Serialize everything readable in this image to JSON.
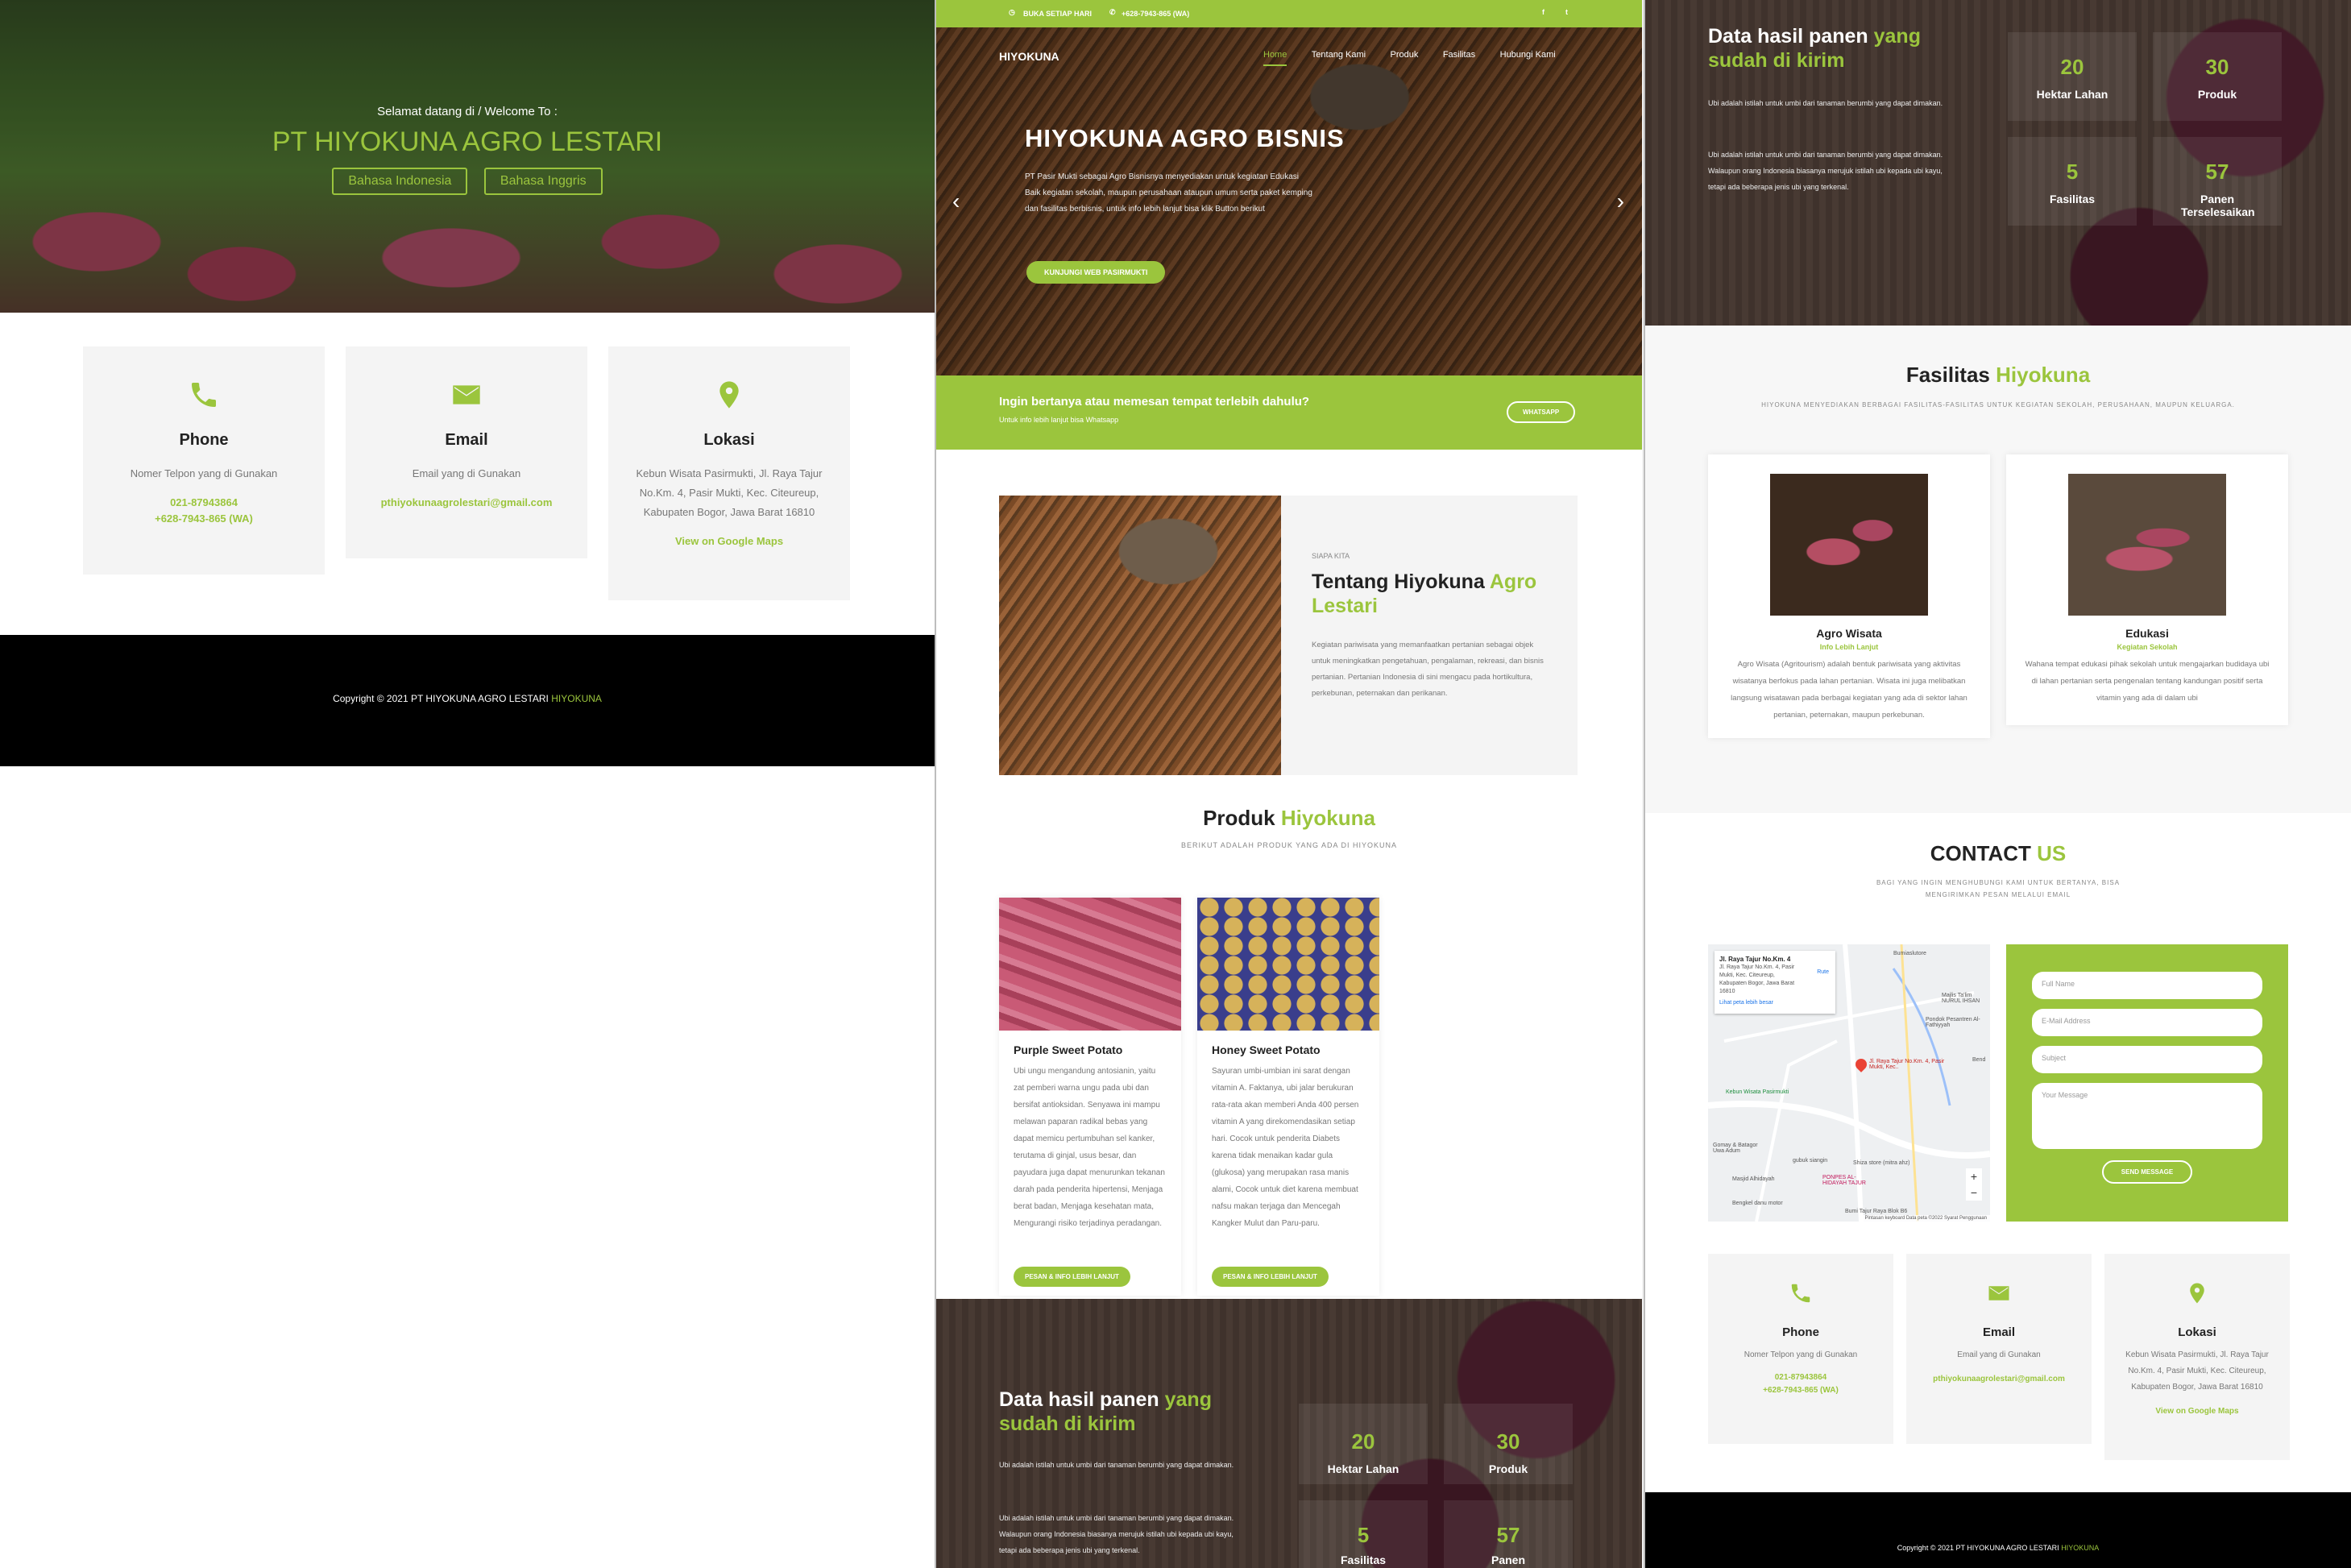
{
  "left": {
    "hero": {
      "welcome": "Selamat datang di / Welcome To :",
      "title": "PT HIYOKUNA AGRO LESTARI",
      "btn_id": "Bahasa Indonesia",
      "btn_en": "Bahasa Inggris"
    },
    "contact": [
      {
        "title": "Phone",
        "desc": "Nomer Telpon yang di Gunakan",
        "l1": "021-87943864",
        "l2": "+628-7943-865 (WA)"
      },
      {
        "title": "Email",
        "desc": "Email yang di Gunakan",
        "l1": "pthiyokunaagrolestari@gmail.com"
      },
      {
        "title": "Lokasi",
        "desc": "Kebun Wisata Pasirmukti, Jl. Raya Tajur No.Km. 4, Pasir Mukti, Kec. Citeureup, Kabupaten Bogor, Jawa Barat 16810",
        "l1": "View on Google Maps"
      }
    ],
    "footer": {
      "text": "Copyright © 2021 PT HIYOKUNA AGRO LESTARI",
      "brand": "HIYOKUNA"
    }
  },
  "mid": {
    "topbar": {
      "hours": "BUKA SETIAP HARI",
      "phone": "+628-7943-865 (WA)",
      "fb": "f",
      "tw": "t"
    },
    "nav": {
      "logo": "HIYOKUNA",
      "items": [
        "Home",
        "Tentang Kami",
        "Produk",
        "Fasilitas",
        "Hubungi Kami"
      ]
    },
    "hero": {
      "title": "HIYOKUNA AGRO BISNIS",
      "text": "PT Pasir Mukti sebagai Agro Bisnisnya menyediakan untuk kegiatan Edukasi Baik kegiatan sekolah, maupun perusahaan ataupun umum serta paket kemping dan fasilitas berbisnis, untuk info lebih lanjut bisa klik Button berikut",
      "btn": "KUNJUNGI WEB PASIRMUKTI",
      "prev": "‹",
      "next": "›"
    },
    "cta": {
      "title": "Ingin bertanya atau memesan tempat terlebih dahulu?",
      "sub": "Untuk info lebih lanjut bisa Whatsapp",
      "btn": "WHATSAPP"
    },
    "about": {
      "kicker": "SIAPA KITA",
      "t1": "Tentang Hiyokuna",
      "t2": "Agro",
      "t3": "Lestari",
      "text": "Kegiatan pariwisata yang memanfaatkan pertanian sebagai objek untuk meningkatkan pengetahuan, pengalaman, rekreasi, dan bisnis pertanian. Pertanian Indonesia di sini mengacu pada hortikultura, perkebunan, peternakan dan perikanan."
    },
    "produk": {
      "t1": "Produk",
      "t2": "Hiyokuna",
      "sub": "BERIKUT ADALAH PRODUK YANG ADA DI HIYOKUNA",
      "items": [
        {
          "name": "Purple Sweet Potato",
          "desc": "Ubi ungu mengandung antosianin, yaitu zat pemberi warna ungu pada ubi dan bersifat antioksidan. Senyawa ini mampu melawan paparan radikal bebas yang dapat memicu pertumbuhan sel kanker, terutama di ginjal, usus besar, dan payudara juga dapat menurunkan tekanan darah pada penderita hipertensi, Menjaga berat badan, Menjaga kesehatan mata, Mengurangi risiko terjadinya peradangan.",
          "btn": "PESAN & INFO LEBIH LANJUT"
        },
        {
          "name": "Honey Sweet Potato",
          "desc": "Sayuran umbi-umbian ini sarat dengan vitamin A. Faktanya, ubi jalar berukuran rata-rata akan memberi Anda 400 persen vitamin A yang direkomendasikan setiap hari. Cocok untuk penderita Diabets karena tidak menaikan kadar gula (glukosa) yang merupakan rasa manis alami, Cocok untuk diet karena membuat nafsu makan terjaga dan Mencegah Kangker Mulut dan Paru-paru.",
          "btn": "PESAN & INFO LEBIH LANJUT"
        }
      ]
    },
    "stats": {
      "t1": "Data hasil panen",
      "t2": "yang",
      "t3": "sudah di kirim",
      "p1": "Ubi adalah istilah untuk umbi dari tanaman berumbi yang dapat dimakan.",
      "p2": "Ubi adalah istilah untuk umbi dari tanaman berumbi yang dapat dimakan. Walaupun orang Indonesia biasanya merujuk istilah ubi kepada ubi kayu, tetapi ada beberapa jenis ubi yang terkenal.",
      "items": [
        {
          "n": "20",
          "l": "Hektar Lahan"
        },
        {
          "n": "30",
          "l": "Produk"
        },
        {
          "n": "5",
          "l": "Fasilitas"
        },
        {
          "n": "57",
          "l": "Panen"
        }
      ]
    }
  },
  "right": {
    "stats": {
      "t1": "Data hasil panen",
      "t2": "yang",
      "t3": "sudah di kirim",
      "p1": "Ubi adalah istilah untuk umbi dari tanaman berumbi yang dapat dimakan.",
      "p2": "Ubi adalah istilah untuk umbi dari tanaman berumbi yang dapat dimakan. Walaupun orang Indonesia biasanya merujuk istilah ubi kepada ubi kayu, tetapi ada beberapa jenis ubi yang terkenal.",
      "items": [
        {
          "n": "20",
          "l": "Hektar Lahan"
        },
        {
          "n": "30",
          "l": "Produk"
        },
        {
          "n": "5",
          "l": "Fasilitas"
        },
        {
          "n": "57",
          "l": "Panen Terselesaikan"
        }
      ]
    },
    "fasilitas": {
      "t1": "Fasilitas",
      "t2": "Hiyokuna",
      "sub": "HIYOKUNA MENYEDIAKAN BERBAGAI FASILITAS-FASILITAS UNTUK KEGIATAN SEKOLAH, PERUSAHAAN, MAUPUN KELUARGA.",
      "items": [
        {
          "name": "Agro Wisata",
          "link": "Info Lebih Lanjut",
          "desc": "Agro Wisata (Agritourism) adalah bentuk pariwisata yang aktivitas wisatanya berfokus pada lahan pertanian. Wisata ini juga melibatkan langsung wisatawan pada berbagai kegiatan yang ada di sektor lahan pertanian, peternakan, maupun perkebunan."
        },
        {
          "name": "Edukasi",
          "link": "Kegiatan Sekolah",
          "desc": "Wahana tempat edukasi pihak sekolah untuk mengajarkan budidaya ubi di lahan pertanian serta pengenalan tentang kandungan positif serta vitamin yang ada di dalam ubi"
        }
      ]
    },
    "contactus": {
      "t1": "CONTACT",
      "t2": "US",
      "sub": "BAGI YANG INGIN MENGHUBUNGI KAMI UNTUK BERTANYA, BISA MENGIRIMKAN PESAN MELALUI EMAIL"
    },
    "map": {
      "card_title": "Jl. Raya Tajur No.Km. 4",
      "card_addr": "Jl. Raya Tajur No.Km. 4, Pasir Mukti, Kec. Citeureup, Kabupaten Bogor, Jawa Barat 16810",
      "card_link": "Lihat peta lebih besar",
      "route": "Rute",
      "pin": "Jl. Raya Tajur No.Km. 4, Pasir Mukti, Kec..",
      "labels": [
        "Kebun Wisata Pasirmukti",
        "Masjid Alhidayah",
        "PONPES AL-HIDAYAH TAJUR",
        "Bumiaslutore",
        "Shiza store (mitra ahz)",
        "Bumi Tajur Raya Blok B6",
        "Pondok Pesantren Al-Fathiyyah",
        "Majlis Ta'lim NURUL IHSAN",
        "gubuk siangin",
        "Gomay & Batagor Uwa Adum",
        "Bengkel danu motor",
        "Bend"
      ],
      "plus": "+",
      "minus": "−",
      "footer": "Pintasan keyboard   Data peta ©2022   Syarat Penggunaan"
    },
    "form": {
      "name": "Full Name",
      "email": "E-Mail Address",
      "subject": "Subject",
      "message": "Your Message",
      "btn": "SEND MESSAGE"
    },
    "contact": [
      {
        "title": "Phone",
        "desc": "Nomer Telpon yang di Gunakan",
        "l1": "021-87943864",
        "l2": "+628-7943-865 (WA)"
      },
      {
        "title": "Email",
        "desc": "Email yang di Gunakan",
        "l1": "pthiyokunaagrolestari@gmail.com"
      },
      {
        "title": "Lokasi",
        "desc": "Kebun Wisata Pasirmukti, Jl. Raya Tajur No.Km. 4, Pasir Mukti, Kec. Citeureup, Kabupaten Bogor, Jawa Barat 16810",
        "l1": "View on Google Maps"
      }
    ],
    "footer": {
      "text": "Copyright © 2021 PT HIYOKUNA AGRO LESTARI",
      "brand": "HIYOKUNA"
    }
  },
  "colors": {
    "accent": "#9bc53d",
    "footer": "#000000",
    "panel": "#f4f4f4"
  },
  "icons": [
    "phone-icon",
    "envelope-icon",
    "map-pin-icon",
    "clock-icon",
    "facebook-icon",
    "twitter-icon"
  ]
}
